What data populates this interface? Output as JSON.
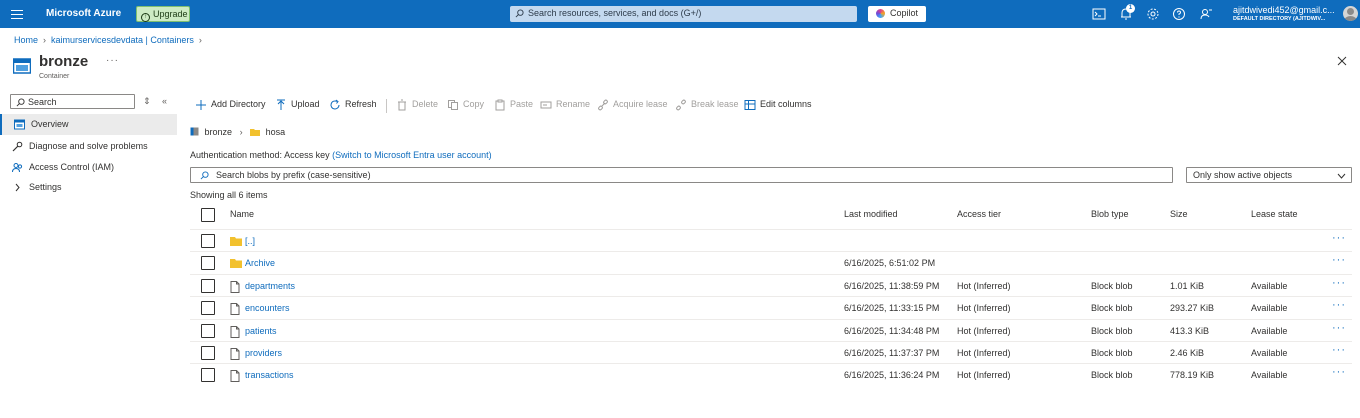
{
  "topbar": {
    "brand": "Microsoft Azure",
    "upgrade_label": "Upgrade",
    "search_placeholder": "Search resources, services, and docs (G+/)",
    "copilot_label": "Copilot",
    "notification_count": "1",
    "user_email": "ajitdwivedi452@gmail.c...",
    "user_directory": "DEFAULT DIRECTORY (AJITDWIV..."
  },
  "breadcrumb": [
    "Home",
    "kaimurservicesdevdata | Containers"
  ],
  "page": {
    "title": "bronze",
    "subtitle": "Container",
    "more": "···"
  },
  "sidebar": {
    "search_placeholder": "Search",
    "items": [
      {
        "label": "Overview",
        "icon": "overview-icon",
        "active": true
      },
      {
        "label": "Diagnose and solve problems",
        "icon": "wrench-icon",
        "active": false
      },
      {
        "label": "Access Control (IAM)",
        "icon": "people-icon",
        "active": false
      },
      {
        "label": "Settings",
        "icon": "chevron-right-icon",
        "active": false
      }
    ]
  },
  "toolbar": {
    "add_directory": "Add Directory",
    "upload": "Upload",
    "refresh": "Refresh",
    "delete": "Delete",
    "copy": "Copy",
    "paste": "Paste",
    "rename": "Rename",
    "acquire_lease": "Acquire lease",
    "break_lease": "Break lease",
    "edit_columns": "Edit columns"
  },
  "path": {
    "container": "bronze",
    "folder": "hosa"
  },
  "auth": {
    "label": "Authentication method:",
    "value": "Access key",
    "switch_link": "(Switch to Microsoft Entra user account)"
  },
  "blob_search_placeholder": "Search blobs by prefix (case-sensitive)",
  "filter_value": "Only show active objects",
  "count_text": "Showing all 6 items",
  "columns": {
    "name": "Name",
    "modified": "Last modified",
    "tier": "Access tier",
    "type": "Blob type",
    "size": "Size",
    "lease": "Lease state"
  },
  "rows": [
    {
      "kind": "folder",
      "name": "[..]",
      "modified": "",
      "tier": "",
      "type": "",
      "size": "",
      "lease": ""
    },
    {
      "kind": "folder",
      "name": "Archive",
      "modified": "6/16/2025, 6:51:02 PM",
      "tier": "",
      "type": "",
      "size": "",
      "lease": ""
    },
    {
      "kind": "file",
      "name": "departments",
      "modified": "6/16/2025, 11:38:59 PM",
      "tier": "Hot (Inferred)",
      "type": "Block blob",
      "size": "1.01 KiB",
      "lease": "Available"
    },
    {
      "kind": "file",
      "name": "encounters",
      "modified": "6/16/2025, 11:33:15 PM",
      "tier": "Hot (Inferred)",
      "type": "Block blob",
      "size": "293.27 KiB",
      "lease": "Available"
    },
    {
      "kind": "file",
      "name": "patients",
      "modified": "6/16/2025, 11:34:48 PM",
      "tier": "Hot (Inferred)",
      "type": "Block blob",
      "size": "413.3 KiB",
      "lease": "Available"
    },
    {
      "kind": "file",
      "name": "providers",
      "modified": "6/16/2025, 11:37:37 PM",
      "tier": "Hot (Inferred)",
      "type": "Block blob",
      "size": "2.46 KiB",
      "lease": "Available"
    },
    {
      "kind": "file",
      "name": "transactions",
      "modified": "6/16/2025, 11:36:24 PM",
      "tier": "Hot (Inferred)",
      "type": "Block blob",
      "size": "778.19 KiB",
      "lease": "Available"
    }
  ],
  "row_more": "···",
  "colors": {
    "accent": "#0f6cbd",
    "folder": "#f2c12e",
    "topbar": "#0f6cbd"
  }
}
